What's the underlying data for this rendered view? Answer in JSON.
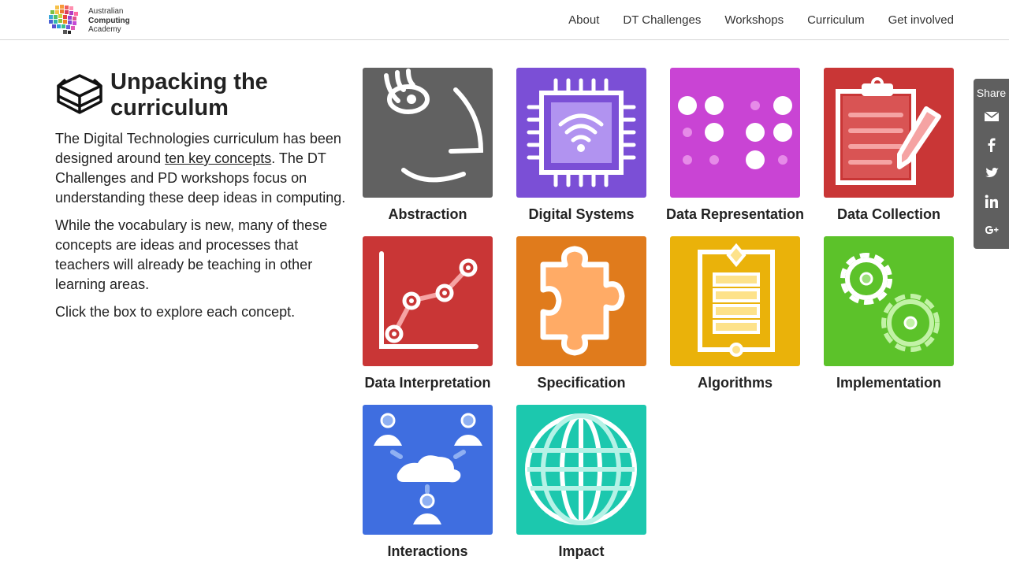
{
  "logo": {
    "line1": "Australian",
    "line2": "Computing",
    "line3": "Academy"
  },
  "nav": [
    "About",
    "DT Challenges",
    "Workshops",
    "Curriculum",
    "Get involved"
  ],
  "intro": {
    "title": "Unpacking the curriculum",
    "p1_before": "The Digital Technologies curriculum has been designed around ",
    "p1_link": "ten key concepts",
    "p1_after": ". The DT Challenges and PD workshops focus on understanding these deep ideas in computing.",
    "p2": "While the vocabulary is new, many of these concepts are ideas and processes that teachers will already be teaching in other learning areas.",
    "p3": "Click the box to explore each concept."
  },
  "concepts": [
    {
      "label": "Abstraction",
      "color": "#616161"
    },
    {
      "label": "Digital Systems",
      "color": "#7b4fd6"
    },
    {
      "label": "Data Representation",
      "color": "#c944d4"
    },
    {
      "label": "Data Collection",
      "color": "#c93636"
    },
    {
      "label": "Data Interpretation",
      "color": "#c93636"
    },
    {
      "label": "Specification",
      "color": "#e07b1c"
    },
    {
      "label": "Algorithms",
      "color": "#eab20a"
    },
    {
      "label": "Implementation",
      "color": "#5cc22a"
    },
    {
      "label": "Interactions",
      "color": "#3f6ee0"
    },
    {
      "label": "Impact",
      "color": "#1cc8ae"
    }
  ],
  "share": {
    "label": "Share",
    "icons": [
      "email-icon",
      "facebook-icon",
      "twitter-icon",
      "linkedin-icon",
      "google-plus-icon"
    ]
  }
}
